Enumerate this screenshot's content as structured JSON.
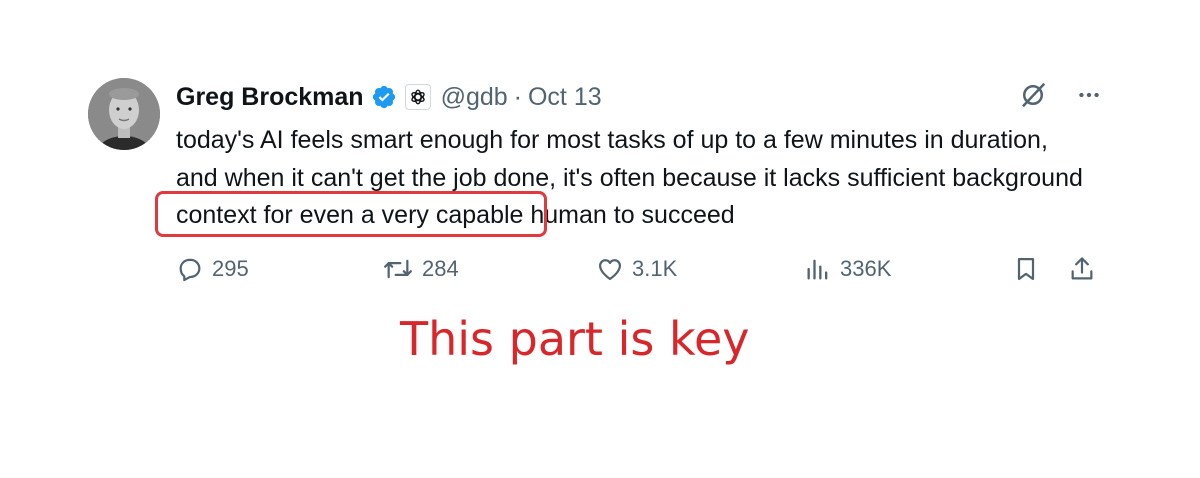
{
  "tweet": {
    "author_name": "Greg Brockman",
    "handle": "@gdb",
    "separator": "·",
    "date": "Oct 13",
    "text": "today's AI feels smart enough for most tasks of up to a few minutes in duration, and when it can't get the job done, it's often because it lacks sufficient background context for even a very capable human to succeed",
    "icons": {
      "avatar": "avatar-photo",
      "verified": "verified-badge-icon",
      "affiliation": "openai-logo-icon",
      "grok": "grok-icon",
      "more": "more-icon"
    },
    "stats": {
      "replies": "295",
      "reposts": "284",
      "likes": "3.1K",
      "views": "336K"
    }
  },
  "annotation": {
    "caption": "This part is key",
    "color": "#e0393e"
  },
  "colors": {
    "verified_blue": "#1d9bf0",
    "secondary_text": "#536471",
    "primary_text": "#0f1419",
    "annotation_red": "#d9262b"
  }
}
